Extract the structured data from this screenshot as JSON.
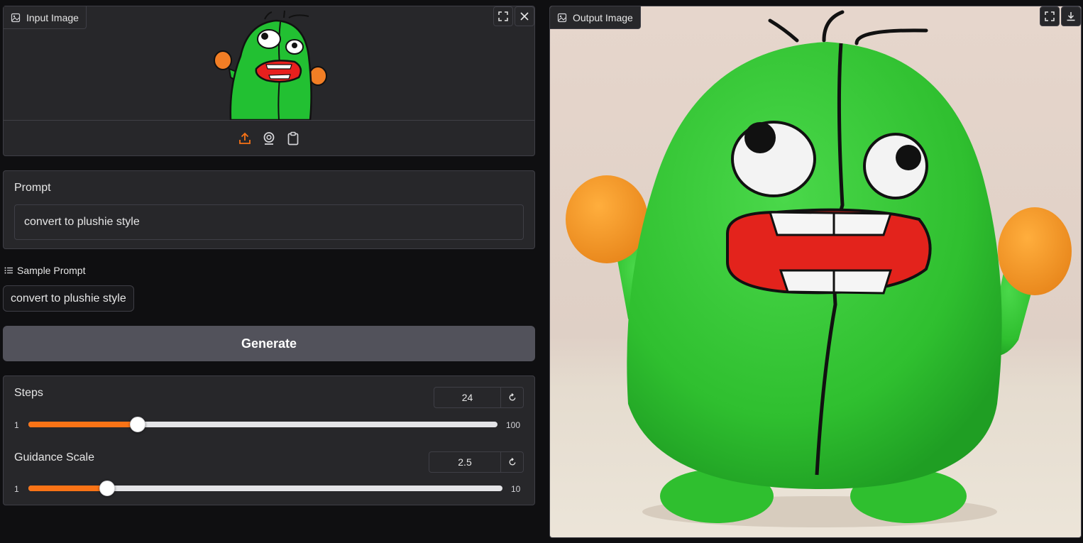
{
  "input_image": {
    "label": "Input Image",
    "icons": [
      "image-icon",
      "fullscreen-icon",
      "close-icon",
      "upload-icon",
      "webcam-icon",
      "clipboard-icon"
    ],
    "accent": "#f97316"
  },
  "prompt": {
    "label": "Prompt",
    "value": "convert to plushie style"
  },
  "samples": {
    "header": "Sample Prompt",
    "items": [
      "convert to plushie style"
    ]
  },
  "generate": {
    "label": "Generate"
  },
  "steps": {
    "label": "Steps",
    "value": "24",
    "min": "1",
    "max": "100",
    "fraction": 0.2323
  },
  "guidance": {
    "label": "Guidance Scale",
    "value": "2.5",
    "min": "1",
    "max": "10",
    "fraction": 0.1667
  },
  "output_image": {
    "label": "Output Image",
    "icons": [
      "image-icon",
      "fullscreen-icon",
      "download-icon"
    ]
  },
  "colors": {
    "background": "#0f0f11",
    "panel": "#27272a",
    "border": "#3f3f46",
    "accent": "#f97316",
    "button": "#52525b"
  }
}
